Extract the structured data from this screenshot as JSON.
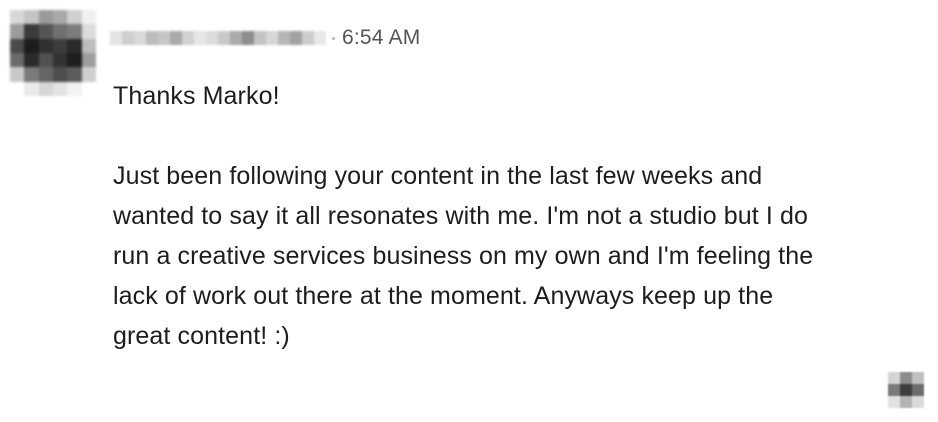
{
  "message": {
    "timestamp": "6:54 AM",
    "greeting": "Thanks Marko!",
    "body": "Just been following your content in the last few weeks and wanted to say it all resonates with me. I'm not a studio but I do run a creative services business on my own and I'm feeling the lack of work out there at the moment. Anyways keep up the great content! :)"
  },
  "colors": {
    "text": "#1d1d1d",
    "timestamp": "#555555",
    "background": "#ffffff"
  },
  "icons": {
    "avatar": "sender-avatar-icon",
    "read_receipt": "read-receipt-avatar-icon"
  }
}
